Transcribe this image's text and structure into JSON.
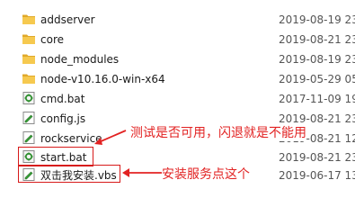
{
  "files": [
    {
      "name": "addserver",
      "date": "2019-08-19 23",
      "type": "folder",
      "icon": "folder-icon"
    },
    {
      "name": "core",
      "date": "2019-08-21 23",
      "type": "folder",
      "icon": "folder-icon"
    },
    {
      "name": "node_modules",
      "date": "2019-08-19 23",
      "type": "folder",
      "icon": "folder-icon"
    },
    {
      "name": "node-v10.16.0-win-x64",
      "date": "2019-05-29 05",
      "type": "folder",
      "icon": "folder-icon"
    },
    {
      "name": "cmd.bat",
      "date": "2017-11-09 19",
      "type": "batch",
      "icon": "batch-file-icon"
    },
    {
      "name": "config.js",
      "date": "2019-08-21 23",
      "type": "script",
      "icon": "script-file-icon"
    },
    {
      "name": "rockservice",
      "date": "2019-08-21 12",
      "type": "script",
      "icon": "script-file-icon"
    },
    {
      "name": "start.bat",
      "date": "2019-08-21 23",
      "type": "batch",
      "icon": "batch-file-icon"
    },
    {
      "name": "双击我安装.vbs",
      "date": "2019-06-17 13",
      "type": "script",
      "icon": "script-file-icon"
    }
  ],
  "annotations": {
    "test_note": "测试是否可用，闪退就是不能用",
    "install_note": "安装服务点这个"
  },
  "colors": {
    "annotation": "#e22222",
    "folder": "#f6c94f",
    "folder_dark": "#e0a92a",
    "batch_gear": "#2f8f2f"
  }
}
